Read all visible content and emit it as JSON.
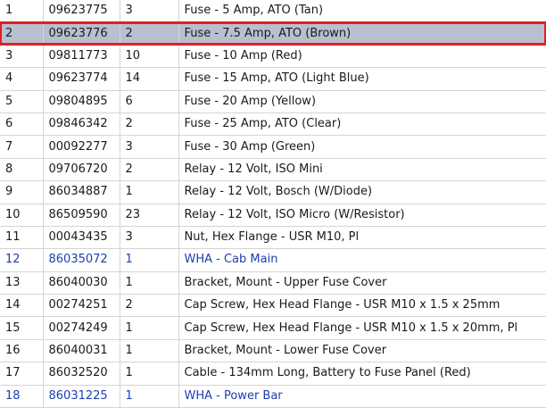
{
  "rows": [
    {
      "no": "1",
      "part": "09623775",
      "qty": "3",
      "desc": "Fuse - 5 Amp, ATO (Tan)",
      "selected": false,
      "link": false
    },
    {
      "no": "2",
      "part": "09623776",
      "qty": "2",
      "desc": "Fuse - 7.5 Amp, ATO (Brown)",
      "selected": true,
      "link": false
    },
    {
      "no": "3",
      "part": "09811773",
      "qty": "10",
      "desc": "Fuse - 10 Amp (Red)",
      "selected": false,
      "link": false
    },
    {
      "no": "4",
      "part": "09623774",
      "qty": "14",
      "desc": "Fuse - 15 Amp, ATO (Light Blue)",
      "selected": false,
      "link": false
    },
    {
      "no": "5",
      "part": "09804895",
      "qty": "6",
      "desc": "Fuse - 20 Amp (Yellow)",
      "selected": false,
      "link": false
    },
    {
      "no": "6",
      "part": "09846342",
      "qty": "2",
      "desc": "Fuse - 25 Amp, ATO (Clear)",
      "selected": false,
      "link": false
    },
    {
      "no": "7",
      "part": "00092277",
      "qty": "3",
      "desc": "Fuse - 30 Amp (Green)",
      "selected": false,
      "link": false
    },
    {
      "no": "8",
      "part": "09706720",
      "qty": "2",
      "desc": "Relay - 12 Volt, ISO Mini",
      "selected": false,
      "link": false
    },
    {
      "no": "9",
      "part": "86034887",
      "qty": "1",
      "desc": "Relay - 12 Volt, Bosch (W/Diode)",
      "selected": false,
      "link": false
    },
    {
      "no": "10",
      "part": "86509590",
      "qty": "23",
      "desc": "Relay - 12 Volt, ISO Micro (W/Resistor)",
      "selected": false,
      "link": false
    },
    {
      "no": "11",
      "part": "00043435",
      "qty": "3",
      "desc": "Nut, Hex Flange - USR M10, Pl",
      "selected": false,
      "link": false
    },
    {
      "no": "12",
      "part": "86035072",
      "qty": "1",
      "desc": "WHA - Cab Main",
      "selected": false,
      "link": true
    },
    {
      "no": "13",
      "part": "86040030",
      "qty": "1",
      "desc": "Bracket, Mount - Upper Fuse Cover",
      "selected": false,
      "link": false
    },
    {
      "no": "14",
      "part": "00274251",
      "qty": "2",
      "desc": "Cap Screw, Hex Head Flange - USR M10 x 1.5 x 25mm",
      "selected": false,
      "link": false
    },
    {
      "no": "15",
      "part": "00274249",
      "qty": "1",
      "desc": "Cap Screw, Hex Head Flange - USR M10 x 1.5 x 20mm, Pl",
      "selected": false,
      "link": false
    },
    {
      "no": "16",
      "part": "86040031",
      "qty": "1",
      "desc": "Bracket, Mount - Lower Fuse Cover",
      "selected": false,
      "link": false
    },
    {
      "no": "17",
      "part": "86032520",
      "qty": "1",
      "desc": "Cable - 134mm Long, Battery to Fuse Panel (Red)",
      "selected": false,
      "link": false
    },
    {
      "no": "18",
      "part": "86031225",
      "qty": "1",
      "desc": "WHA - Power Bar",
      "selected": false,
      "link": true
    }
  ],
  "colors": {
    "selected_bg": "#b8bfcf",
    "selected_outline": "#e02020",
    "link_text": "#1d3fb0",
    "grid_line": "#d4d4d4"
  }
}
